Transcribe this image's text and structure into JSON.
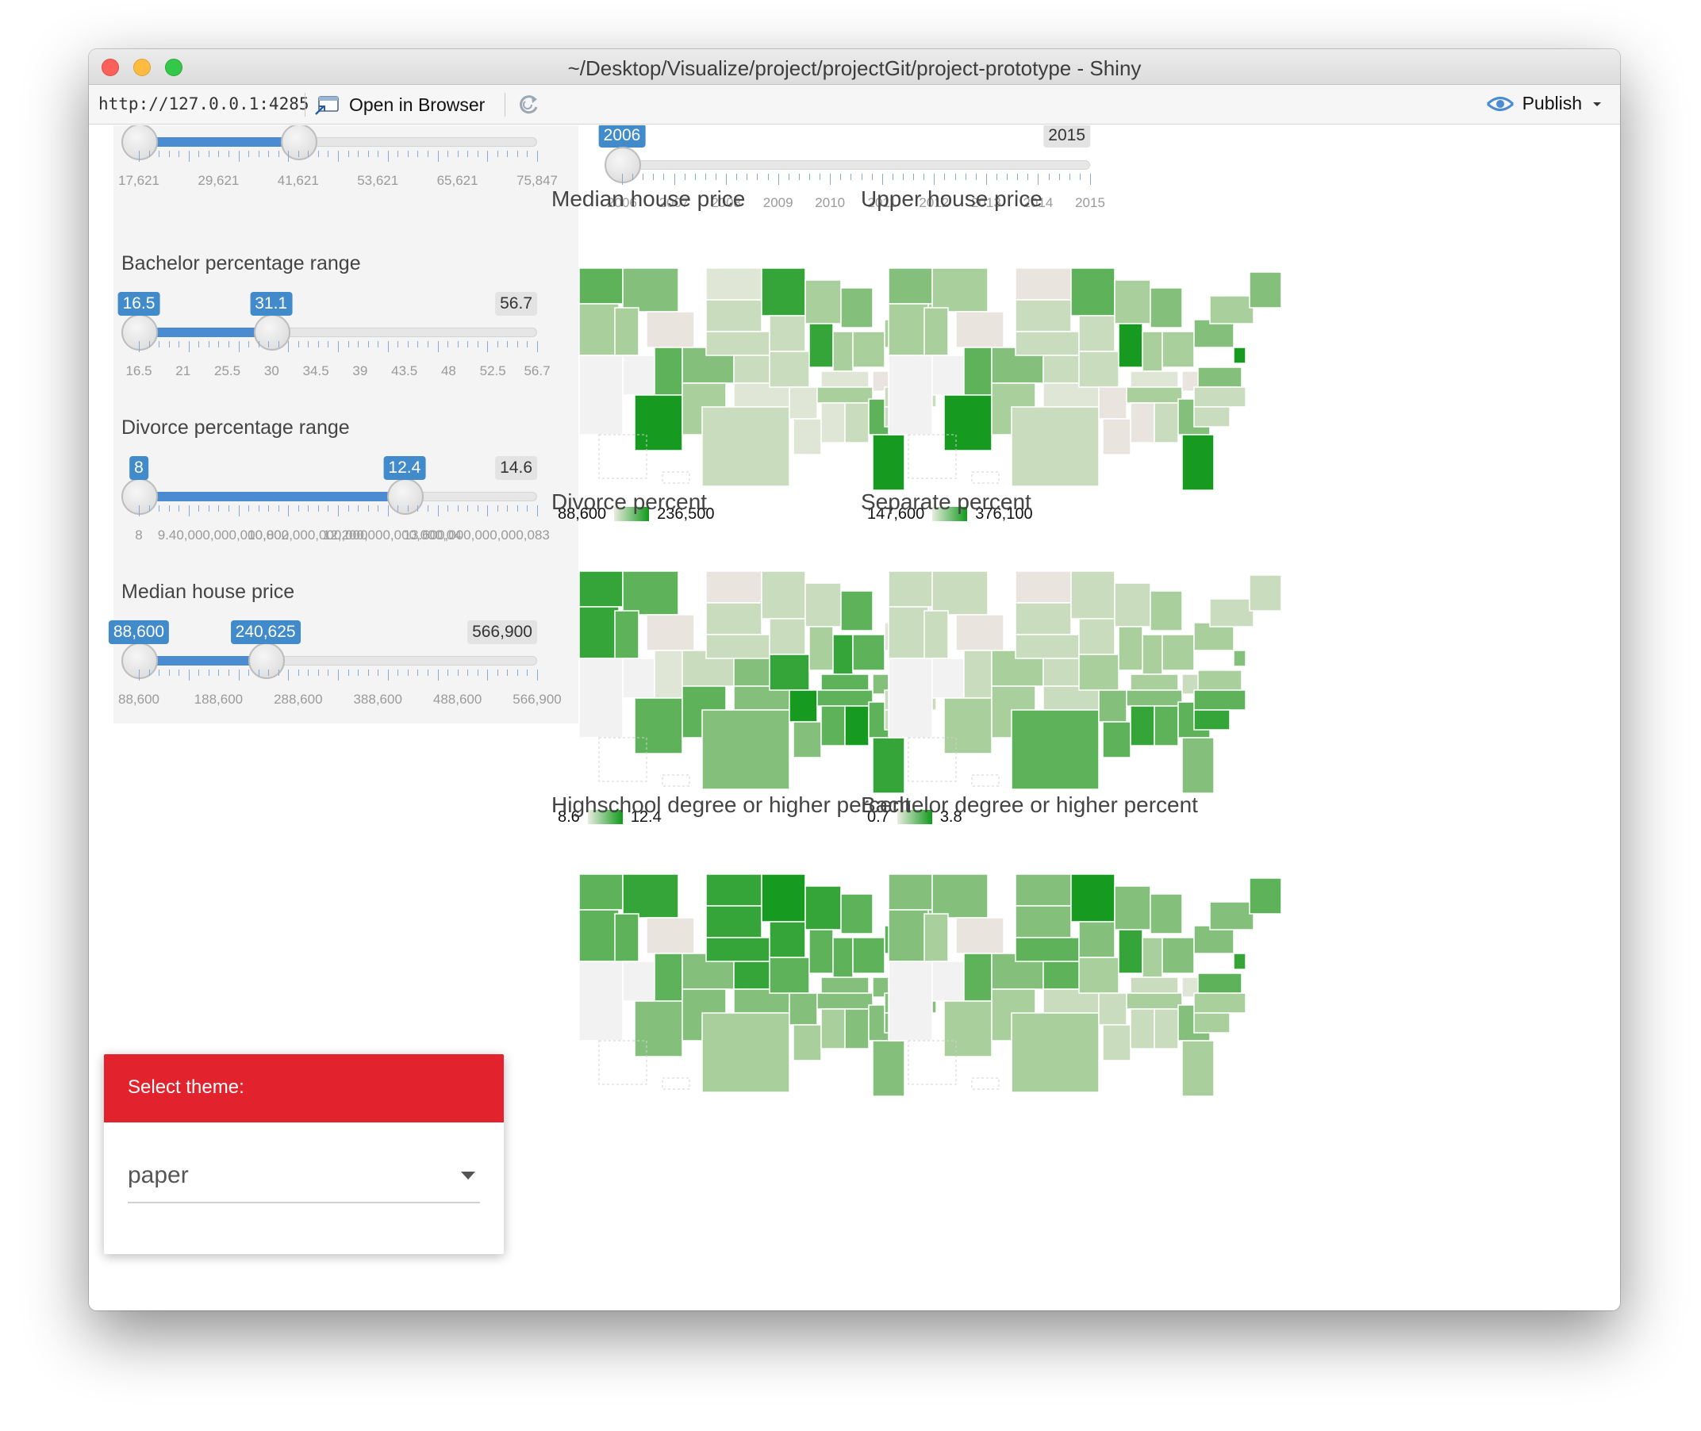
{
  "window": {
    "title": "~/Desktop/Visualize/project/projectGit/project-prototype - Shiny"
  },
  "toolbar": {
    "url": "http://127.0.0.1:4285",
    "open_browser_label": "Open in Browser",
    "publish_label": "Publish"
  },
  "sliders": [
    {
      "id": "income",
      "label": "",
      "min_value": "17,621",
      "high_value": "",
      "max_value": "",
      "low_frac": 0.0,
      "high_frac": 0.4,
      "tick_labels": [
        "17,621",
        "29,621",
        "41,621",
        "53,621",
        "65,621",
        "75,847"
      ]
    },
    {
      "id": "bachelor",
      "label": "Bachelor percentage range",
      "low": "16.5",
      "high": "31.1",
      "max": "56.7",
      "low_frac": 0.0,
      "high_frac": 0.332,
      "tick_labels": [
        "16.5",
        "21",
        "25.5",
        "30",
        "34.5",
        "39",
        "43.5",
        "48",
        "52.5",
        "56.7"
      ]
    },
    {
      "id": "divorce",
      "label": "Divorce percentage range",
      "low": "8",
      "high": "12.4",
      "max": "14.6",
      "low_frac": 0.0,
      "high_frac": 0.667,
      "tick_labels": [
        "8",
        "9.40,000,000,000,002",
        "10,800,000,000,000",
        "12,200,000,000,000,04",
        "13.600,000,000,000,083"
      ]
    },
    {
      "id": "median_price",
      "label": "Median house price",
      "low": "88,600",
      "high": "240,625",
      "max": "566,900",
      "low_frac": 0.0,
      "high_frac": 0.318,
      "tick_labels": [
        "88,600",
        "188,600",
        "288,600",
        "388,600",
        "488,600",
        "566,900"
      ]
    }
  ],
  "year_slider": {
    "value": "2006",
    "max": "2015",
    "value_frac": 0.0,
    "tick_labels": [
      "2006",
      "2007",
      "2008",
      "2009",
      "2010",
      "2011",
      "2012",
      "2013",
      "2014",
      "2015"
    ]
  },
  "theme": {
    "header": "Select theme:",
    "value": "paper"
  },
  "charts": [
    {
      "title": "Median house price",
      "legend_min": "88,600",
      "legend_max": "236,500",
      "scheme": "price"
    },
    {
      "title": "Upper house price",
      "legend_min": "147,600",
      "legend_max": "376,100",
      "scheme": "upper"
    },
    {
      "title": "Divorce percent",
      "legend_min": "8.6",
      "legend_max": "12.4",
      "scheme": "divorce"
    },
    {
      "title": "Separate percent",
      "legend_min": "0.7",
      "legend_max": "3.8",
      "scheme": "separate"
    },
    {
      "title": "Highschool degree or higher percent",
      "legend_min": "",
      "legend_max": "",
      "scheme": "highschool"
    },
    {
      "title": "Bachelor degree or higher percent",
      "legend_min": "",
      "legend_max": "",
      "scheme": "bachelor"
    }
  ],
  "colors": {
    "accent_blue": "#428bca",
    "theme_header_red": "#e2222c",
    "map_low": "#e8ecdf",
    "map_high": "#119a1c",
    "map_nodata": "#f5f5f5"
  }
}
